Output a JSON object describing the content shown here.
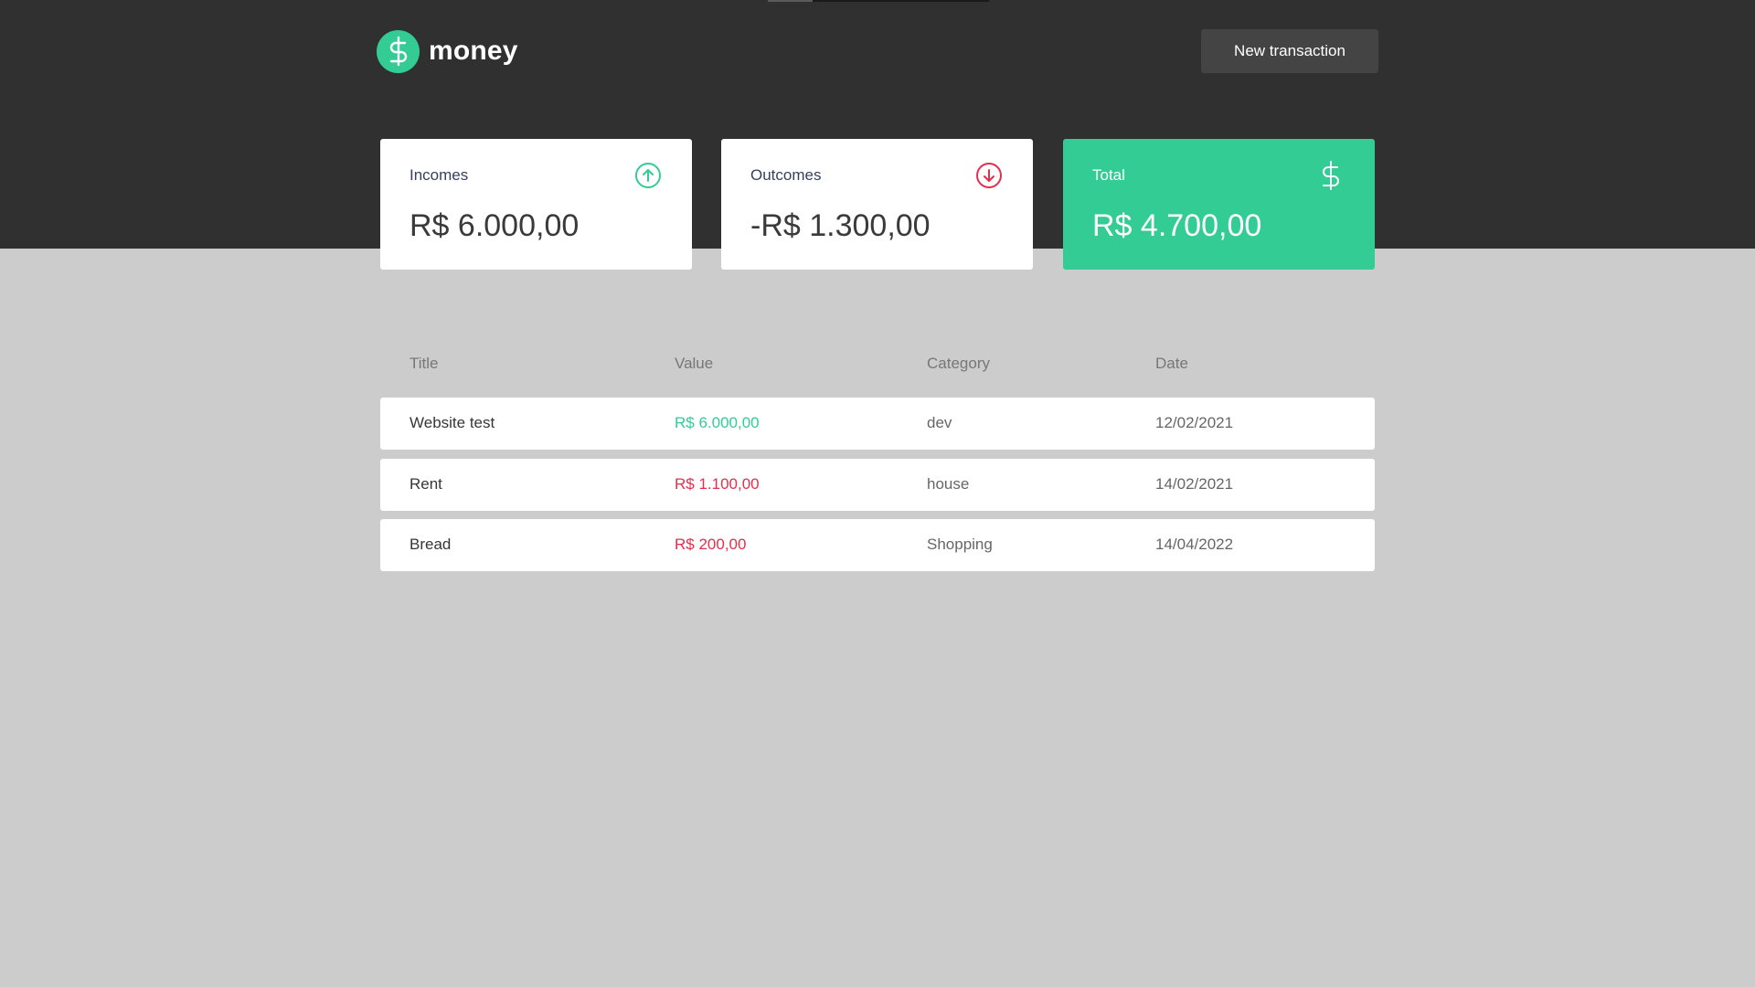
{
  "app": {
    "logo_text": "money",
    "logo_icon": "dollar-icon",
    "new_transaction_label": "New transaction"
  },
  "colors": {
    "header_bg": "#303030",
    "page_bg": "#cccccc",
    "accent": "#33cc95",
    "income": "#33cc95",
    "outcome": "#e52e4d"
  },
  "summary": {
    "incomes": {
      "label": "Incomes",
      "amount": "R$ 6.000,00",
      "icon": "arrow-up-circle-icon"
    },
    "outcomes": {
      "label": "Outcomes",
      "amount": "-R$ 1.300,00",
      "icon": "arrow-down-circle-icon"
    },
    "total": {
      "label": "Total",
      "amount": "R$ 4.700,00",
      "icon": "dollar-icon"
    }
  },
  "table": {
    "headers": {
      "title": "Title",
      "value": "Value",
      "category": "Category",
      "date": "Date"
    },
    "rows": [
      {
        "title": "Website test",
        "value": "R$ 6.000,00",
        "type": "income",
        "category": "dev",
        "date": "12/02/2021"
      },
      {
        "title": "Rent",
        "value": "R$ 1.100,00",
        "type": "outcome",
        "category": "house",
        "date": "14/02/2021"
      },
      {
        "title": "Bread",
        "value": "R$ 200,00",
        "type": "outcome",
        "category": "Shopping",
        "date": "14/04/2022"
      }
    ]
  }
}
